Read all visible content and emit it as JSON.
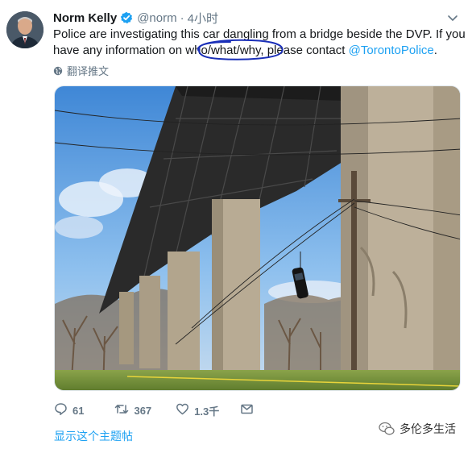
{
  "tweet": {
    "author_name": "Norm Kelly",
    "handle": "@norm",
    "separator": "·",
    "time": "4小时",
    "text_part1": "Police are investigating this car dangling from a bridge beside the DVP. If you have any information on ",
    "text_circled": "who/what/why,",
    "text_part2": " please contact ",
    "mention": "@TorontoPolice",
    "text_end": ".",
    "translate_label": "翻译推文",
    "replies": "61",
    "retweets": "367",
    "likes": "1.3千",
    "show_thread": "显示这个主题帖"
  },
  "watermark": {
    "label": "多伦多生活"
  },
  "colors": {
    "accent": "#1da1f2",
    "muted": "#657786",
    "ink_circle": "#1a2fb8"
  },
  "icons": [
    "verified-badge-icon",
    "chevron-down-icon",
    "globe-icon",
    "reply-icon",
    "retweet-icon",
    "like-icon",
    "message-icon",
    "wechat-icon"
  ]
}
